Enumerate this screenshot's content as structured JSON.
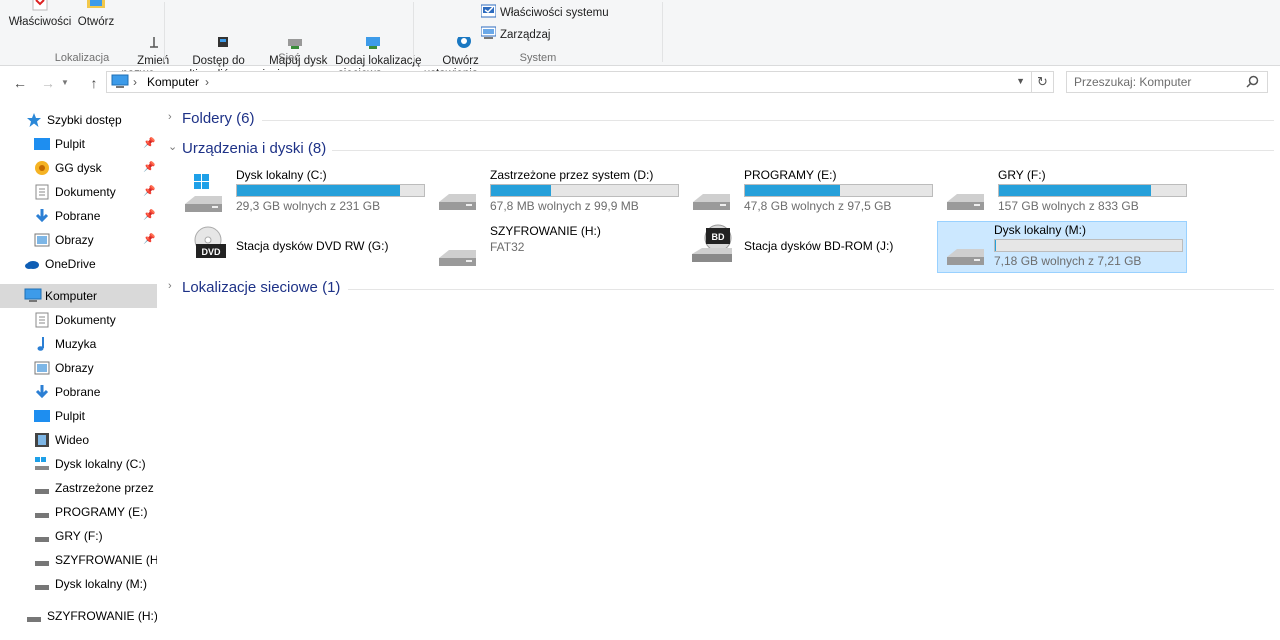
{
  "ribbon": {
    "lokalizacja": {
      "name": "Lokalizacja",
      "buttons": [
        "Właściwości",
        "Otwórz",
        "Zmień\nnazwę"
      ]
    },
    "siec": {
      "name": "Sieć",
      "buttons": [
        "Dostęp do\nmultimediów",
        "Mapuj dysk\nsieciowy",
        "Dodaj lokalizację\nsieciową"
      ]
    },
    "system": {
      "name": "System",
      "open_settings": "Otwórz\nustawienia",
      "system_properties": "Właściwości systemu",
      "manage": "Zarządzaj"
    }
  },
  "address": {
    "crumb": "Komputer",
    "search_placeholder": "Przeszukaj: Komputer"
  },
  "sidebar": {
    "quick_access": "Szybki dostęp",
    "quick_items": [
      "Pulpit",
      "GG dysk",
      "Dokumenty",
      "Pobrane",
      "Obrazy"
    ],
    "onedrive": "OneDrive",
    "computer": "Komputer",
    "computer_items": [
      "Dokumenty",
      "Muzyka",
      "Obrazy",
      "Pobrane",
      "Pulpit",
      "Wideo",
      "Dysk lokalny (C:)",
      "Zastrzeżone przez sy",
      "PROGRAMY (E:)",
      "GRY (F:)",
      "SZYFROWANIE (H:)",
      "Dysk lokalny (M:)"
    ],
    "network_drive": "SZYFROWANIE (H:)"
  },
  "content": {
    "sections": {
      "folders": "Foldery (6)",
      "devices": "Urządzenia i dyski (8)",
      "network": "Lokalizacje sieciowe (1)"
    },
    "drives": [
      {
        "name": "Dysk lokalny (C:)",
        "free": "29,3 GB wolnych z 231 GB",
        "used_fraction": 0.873
      },
      {
        "name": "Zastrzeżone przez system (D:)",
        "free": "67,8 MB wolnych z 99,9 MB",
        "used_fraction": 0.321
      },
      {
        "name": "PROGRAMY (E:)",
        "free": "47,8 GB wolnych z 97,5 GB",
        "used_fraction": 0.51
      },
      {
        "name": "GRY (F:)",
        "free": "157 GB wolnych z 833 GB",
        "used_fraction": 0.812
      },
      {
        "name": "Stacja dysków DVD RW (G:)"
      },
      {
        "name": "SZYFROWANIE (H:)",
        "sub": "FAT32"
      },
      {
        "name": "Stacja dysków BD-ROM (J:)"
      },
      {
        "name": "Dysk lokalny (M:)",
        "free": "7,18 GB wolnych z 7,21 GB",
        "used_fraction": 0.004
      }
    ]
  },
  "colors": {
    "accent_bar": "#26a0da",
    "section_title": "#1e3287",
    "selection": "#cce8ff"
  }
}
